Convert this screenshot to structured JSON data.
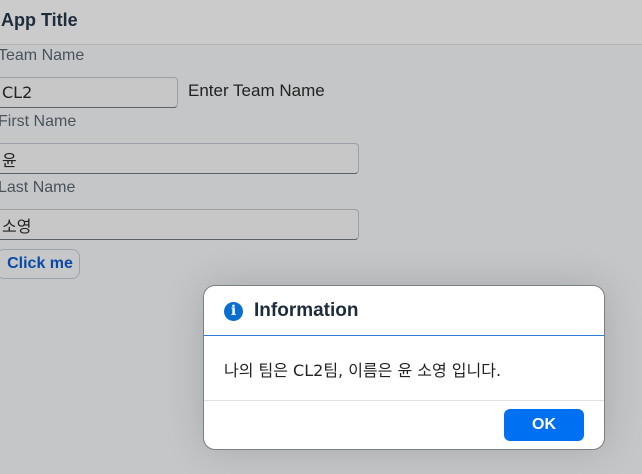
{
  "app": {
    "title": "App Title"
  },
  "form": {
    "team_name": {
      "label": "Team Name",
      "value": "CL2",
      "hint": "Enter Team Name"
    },
    "first_name": {
      "label": "First Name",
      "value": "윤"
    },
    "last_name": {
      "label": "Last Name",
      "value": "소영"
    },
    "button_label": "Click me"
  },
  "dialog": {
    "icon": "info-icon",
    "icon_glyph": "i",
    "title": "Information",
    "message": "나의 팀은 CL2팀, 이름은 윤 소영 입니다.",
    "ok_label": "OK",
    "accent_color": "#0070f2"
  }
}
